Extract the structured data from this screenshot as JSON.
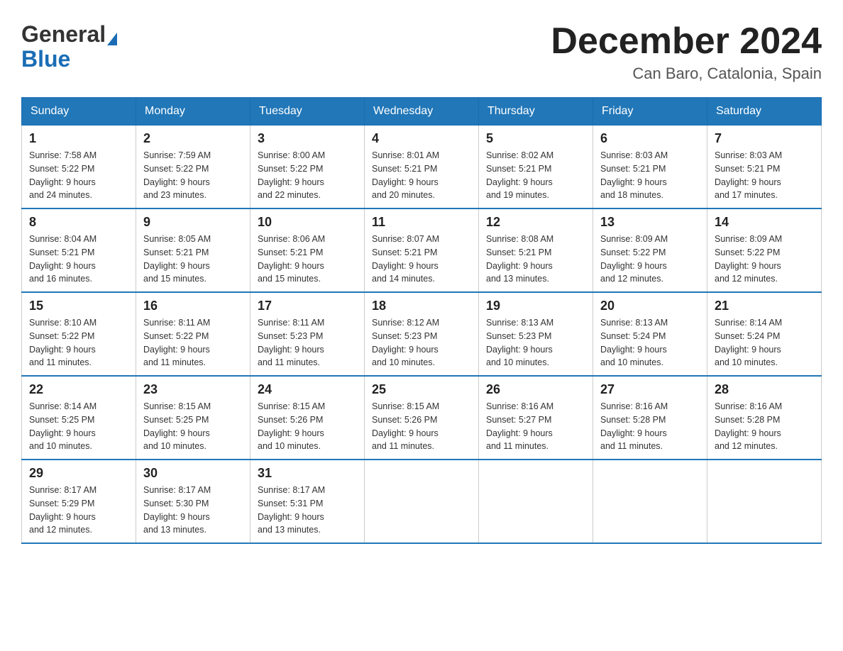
{
  "logo": {
    "general": "General",
    "blue": "Blue"
  },
  "title": "December 2024",
  "location": "Can Baro, Catalonia, Spain",
  "days_of_week": [
    "Sunday",
    "Monday",
    "Tuesday",
    "Wednesday",
    "Thursday",
    "Friday",
    "Saturday"
  ],
  "weeks": [
    [
      {
        "day": "1",
        "sunrise": "7:58 AM",
        "sunset": "5:22 PM",
        "daylight": "9 hours and 24 minutes."
      },
      {
        "day": "2",
        "sunrise": "7:59 AM",
        "sunset": "5:22 PM",
        "daylight": "9 hours and 23 minutes."
      },
      {
        "day": "3",
        "sunrise": "8:00 AM",
        "sunset": "5:22 PM",
        "daylight": "9 hours and 22 minutes."
      },
      {
        "day": "4",
        "sunrise": "8:01 AM",
        "sunset": "5:21 PM",
        "daylight": "9 hours and 20 minutes."
      },
      {
        "day": "5",
        "sunrise": "8:02 AM",
        "sunset": "5:21 PM",
        "daylight": "9 hours and 19 minutes."
      },
      {
        "day": "6",
        "sunrise": "8:03 AM",
        "sunset": "5:21 PM",
        "daylight": "9 hours and 18 minutes."
      },
      {
        "day": "7",
        "sunrise": "8:03 AM",
        "sunset": "5:21 PM",
        "daylight": "9 hours and 17 minutes."
      }
    ],
    [
      {
        "day": "8",
        "sunrise": "8:04 AM",
        "sunset": "5:21 PM",
        "daylight": "9 hours and 16 minutes."
      },
      {
        "day": "9",
        "sunrise": "8:05 AM",
        "sunset": "5:21 PM",
        "daylight": "9 hours and 15 minutes."
      },
      {
        "day": "10",
        "sunrise": "8:06 AM",
        "sunset": "5:21 PM",
        "daylight": "9 hours and 15 minutes."
      },
      {
        "day": "11",
        "sunrise": "8:07 AM",
        "sunset": "5:21 PM",
        "daylight": "9 hours and 14 minutes."
      },
      {
        "day": "12",
        "sunrise": "8:08 AM",
        "sunset": "5:21 PM",
        "daylight": "9 hours and 13 minutes."
      },
      {
        "day": "13",
        "sunrise": "8:09 AM",
        "sunset": "5:22 PM",
        "daylight": "9 hours and 12 minutes."
      },
      {
        "day": "14",
        "sunrise": "8:09 AM",
        "sunset": "5:22 PM",
        "daylight": "9 hours and 12 minutes."
      }
    ],
    [
      {
        "day": "15",
        "sunrise": "8:10 AM",
        "sunset": "5:22 PM",
        "daylight": "9 hours and 11 minutes."
      },
      {
        "day": "16",
        "sunrise": "8:11 AM",
        "sunset": "5:22 PM",
        "daylight": "9 hours and 11 minutes."
      },
      {
        "day": "17",
        "sunrise": "8:11 AM",
        "sunset": "5:23 PM",
        "daylight": "9 hours and 11 minutes."
      },
      {
        "day": "18",
        "sunrise": "8:12 AM",
        "sunset": "5:23 PM",
        "daylight": "9 hours and 10 minutes."
      },
      {
        "day": "19",
        "sunrise": "8:13 AM",
        "sunset": "5:23 PM",
        "daylight": "9 hours and 10 minutes."
      },
      {
        "day": "20",
        "sunrise": "8:13 AM",
        "sunset": "5:24 PM",
        "daylight": "9 hours and 10 minutes."
      },
      {
        "day": "21",
        "sunrise": "8:14 AM",
        "sunset": "5:24 PM",
        "daylight": "9 hours and 10 minutes."
      }
    ],
    [
      {
        "day": "22",
        "sunrise": "8:14 AM",
        "sunset": "5:25 PM",
        "daylight": "9 hours and 10 minutes."
      },
      {
        "day": "23",
        "sunrise": "8:15 AM",
        "sunset": "5:25 PM",
        "daylight": "9 hours and 10 minutes."
      },
      {
        "day": "24",
        "sunrise": "8:15 AM",
        "sunset": "5:26 PM",
        "daylight": "9 hours and 10 minutes."
      },
      {
        "day": "25",
        "sunrise": "8:15 AM",
        "sunset": "5:26 PM",
        "daylight": "9 hours and 11 minutes."
      },
      {
        "day": "26",
        "sunrise": "8:16 AM",
        "sunset": "5:27 PM",
        "daylight": "9 hours and 11 minutes."
      },
      {
        "day": "27",
        "sunrise": "8:16 AM",
        "sunset": "5:28 PM",
        "daylight": "9 hours and 11 minutes."
      },
      {
        "day": "28",
        "sunrise": "8:16 AM",
        "sunset": "5:28 PM",
        "daylight": "9 hours and 12 minutes."
      }
    ],
    [
      {
        "day": "29",
        "sunrise": "8:17 AM",
        "sunset": "5:29 PM",
        "daylight": "9 hours and 12 minutes."
      },
      {
        "day": "30",
        "sunrise": "8:17 AM",
        "sunset": "5:30 PM",
        "daylight": "9 hours and 13 minutes."
      },
      {
        "day": "31",
        "sunrise": "8:17 AM",
        "sunset": "5:31 PM",
        "daylight": "9 hours and 13 minutes."
      },
      null,
      null,
      null,
      null
    ]
  ],
  "labels": {
    "sunrise": "Sunrise:",
    "sunset": "Sunset:",
    "daylight": "Daylight:"
  },
  "colors": {
    "header_bg": "#2177b8",
    "accent_blue": "#1a6db5"
  }
}
